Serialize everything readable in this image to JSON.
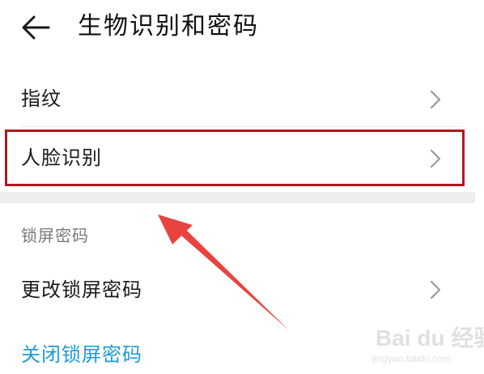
{
  "header": {
    "back_icon": "arrow-left-icon",
    "title": "生物识别和密码"
  },
  "rows": {
    "fingerprint": {
      "label": "指纹",
      "icon": "chevron-right-icon"
    },
    "face_recognition": {
      "label": "人脸识别",
      "icon": "chevron-right-icon",
      "highlighted": true
    },
    "change_lock_password": {
      "label": "更改锁屏密码",
      "icon": "chevron-right-icon"
    }
  },
  "sections": {
    "lock_screen_password": "锁屏密码"
  },
  "actions": {
    "disable_lock_password": "关闭锁屏密码"
  },
  "annotation": {
    "highlight_color": "#b0181c",
    "arrow_color": "#e8433e"
  },
  "watermark": {
    "logo": "Bai du 经验",
    "domain": "jingyan.baidu.com"
  },
  "colors": {
    "link": "#1d9bd6",
    "section_header": "#7a7a7a"
  }
}
